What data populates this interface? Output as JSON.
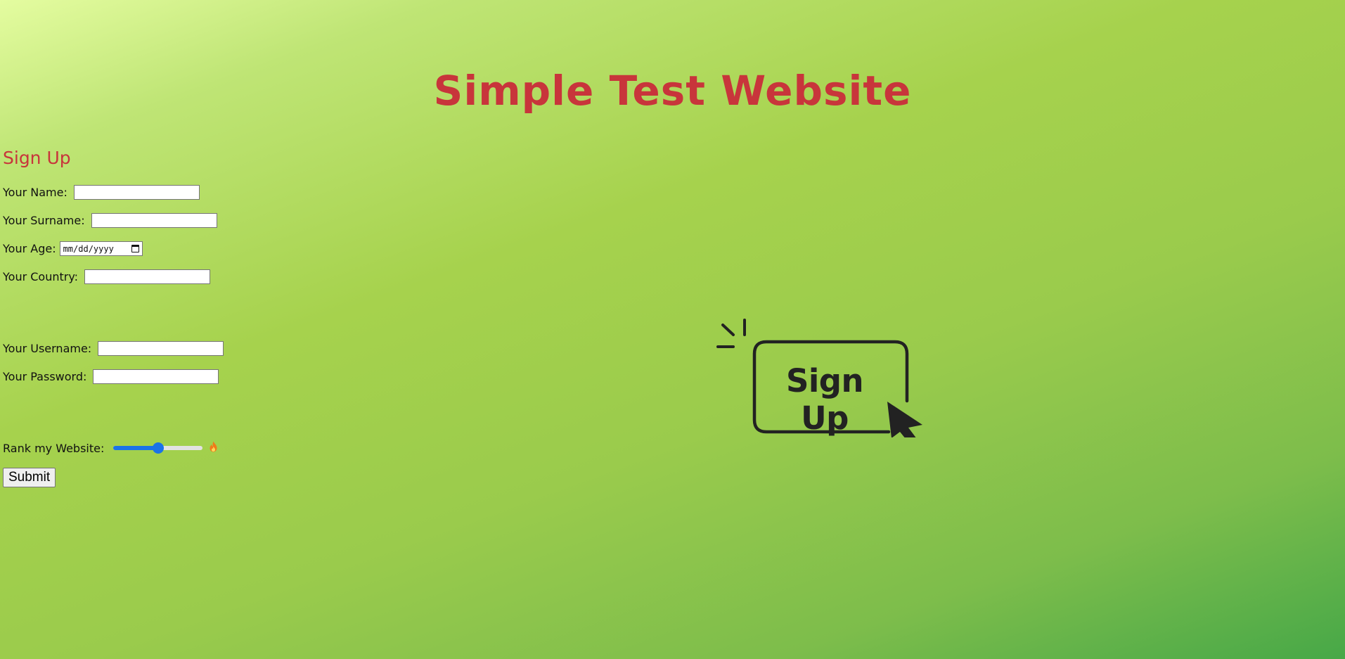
{
  "page": {
    "title": "Simple Test Website"
  },
  "form": {
    "heading": "Sign Up",
    "fields": {
      "name": {
        "label": "Your Name:",
        "value": ""
      },
      "surname": {
        "label": "Your Surname:",
        "value": ""
      },
      "age": {
        "label": "Your Age:",
        "placeholder": "mm/dd/yyyy"
      },
      "country": {
        "label": "Your Country:",
        "value": ""
      },
      "username": {
        "label": "Your Username:",
        "value": ""
      },
      "password": {
        "label": "Your Password:",
        "value": ""
      }
    },
    "rank": {
      "label": "Rank my Website:",
      "value_fraction": 0.5,
      "icon": "fire-icon"
    },
    "submit_label": "Submit"
  },
  "graphic": {
    "text": "Sign Up",
    "icons": [
      "cursor-arrow-icon",
      "click-burst-icon"
    ]
  },
  "colors": {
    "accent": "#c8353b",
    "slider": "#1a73e8"
  }
}
